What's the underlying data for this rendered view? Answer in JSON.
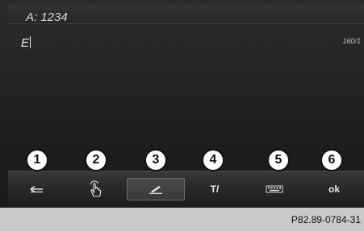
{
  "header": {
    "text": "A: 1234"
  },
  "input": {
    "value": "E",
    "counter": "160/1"
  },
  "toolbar": {
    "items": [
      {
        "icon": "back-arrow-icon",
        "label": ""
      },
      {
        "icon": "handwriting-hand-icon",
        "label": ""
      },
      {
        "icon": "pen-icon",
        "label": ""
      },
      {
        "icon": "text-input-icon",
        "label": "T/"
      },
      {
        "icon": "keyboard-icon",
        "label": ""
      },
      {
        "icon": "",
        "label": "ok"
      }
    ]
  },
  "callouts": [
    "1",
    "2",
    "3",
    "4",
    "5",
    "6"
  ],
  "caption": "P82.89-0784-31"
}
